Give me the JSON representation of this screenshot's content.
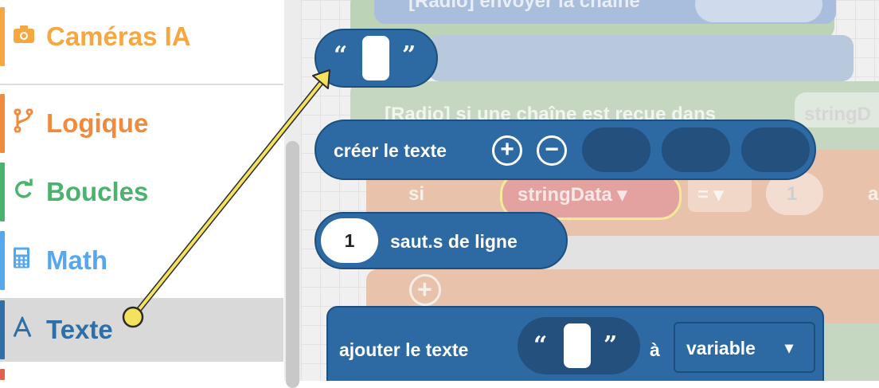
{
  "sidebar": {
    "categories": [
      {
        "label": "Caméras IA",
        "icon": "camera-icon",
        "color": "#f5a742"
      },
      {
        "label": "Logique",
        "icon": "branch-icon",
        "color": "#f08a3c"
      },
      {
        "label": "Boucles",
        "icon": "refresh-icon",
        "color": "#4cb36e"
      },
      {
        "label": "Math",
        "icon": "calculator-icon",
        "color": "#57a7ee"
      },
      {
        "label": "Texte",
        "icon": "text-icon",
        "color": "#2f6fa6",
        "selected": true
      }
    ]
  },
  "workspace": {
    "ghost_radio_send": "[Radio] envoyer la chaîne",
    "ghost_radio_receive": "[Radio] si une chaîne est reçue dans",
    "ghost_stringdata_right": "stringD",
    "ghost_si": "si",
    "ghost_stringdata": "stringData ▾",
    "ghost_eq": "= ▾",
    "ghost_one": "1",
    "ghost_a": "a",
    "blocks": {
      "text_literal": {
        "open_quote": "“",
        "close_quote": "”"
      },
      "create_text": {
        "label": "créer le texte"
      },
      "newlines": {
        "value": "1",
        "label": "saut.s de ligne"
      },
      "append_text": {
        "label": "ajouter le texte",
        "open_quote": "“",
        "close_quote": "”",
        "to": "à",
        "variable": "variable",
        "dropdown": "▾"
      }
    }
  },
  "colors": {
    "block": "#2d6aa3",
    "block_border": "#1d4f7e",
    "arrow": "#f5e25c"
  }
}
